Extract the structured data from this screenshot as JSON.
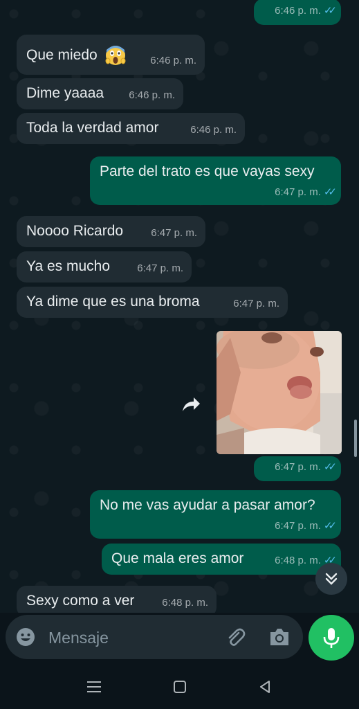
{
  "messages": [
    {
      "dir": "out",
      "time": "6:46 p. m.",
      "read": true
    },
    {
      "dir": "in",
      "text": "Que miedo",
      "emoji": "scream-emoji",
      "time": "6:46 p. m."
    },
    {
      "dir": "in",
      "text": "Dime yaaaa",
      "time": "6:46 p. m."
    },
    {
      "dir": "in",
      "text": "Toda la verdad amor",
      "time": "6:46 p. m."
    },
    {
      "dir": "out",
      "text": "Parte del trato es que vayas sexy",
      "time": "6:47 p. m.",
      "read": true
    },
    {
      "dir": "in",
      "text": "Noooo Ricardo",
      "time": "6:47 p. m."
    },
    {
      "dir": "in",
      "text": "Ya es mucho",
      "time": "6:47 p. m."
    },
    {
      "dir": "in",
      "text": "Ya dime que es una broma",
      "time": "6:47 p. m."
    },
    {
      "dir": "out",
      "type": "image",
      "time": "6:47 p. m.",
      "read": true
    },
    {
      "dir": "out",
      "text": "No me vas ayudar a pasar amor?",
      "time": "6:47 p. m.",
      "read": true
    },
    {
      "dir": "out",
      "text": "Que mala eres amor",
      "time": "6:48 p. m.",
      "read": true
    },
    {
      "dir": "in",
      "text": "Sexy como a ver",
      "time": "6:48 p. m."
    }
  ],
  "composer": {
    "placeholder": "Mensaje"
  },
  "icons": {
    "emoji": "emoji-icon",
    "attach": "paperclip-icon",
    "camera": "camera-icon",
    "mic": "mic-icon",
    "forward": "forward-icon",
    "scroll_down": "double-chevron-down-icon",
    "nav_menu": "menu-icon",
    "nav_home": "home-icon",
    "nav_back": "back-icon"
  },
  "colors": {
    "incoming": "#202c33",
    "outgoing": "#005c4b",
    "accent": "#21c063",
    "read_ticks": "#53bdeb"
  }
}
